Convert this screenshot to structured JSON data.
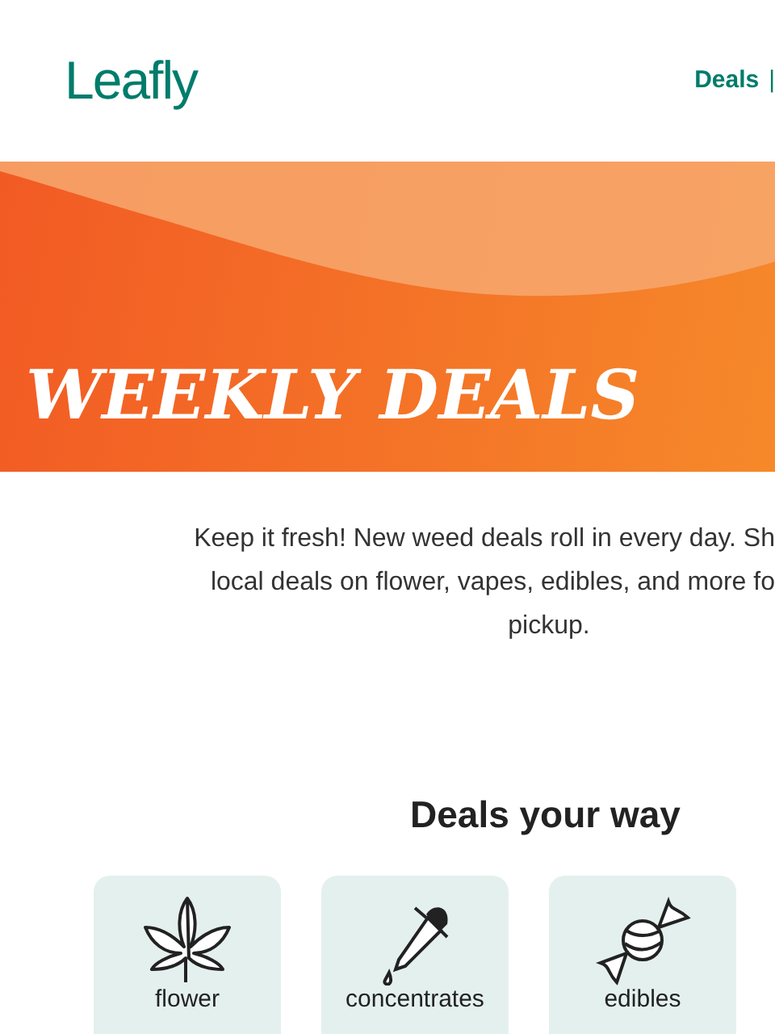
{
  "header": {
    "logo": "Leafly",
    "nav": [
      {
        "label": "Deals",
        "kind": "link"
      },
      {
        "label": "|",
        "kind": "separator"
      }
    ]
  },
  "banner": {
    "title": "WEEKLY DEALS"
  },
  "intro": {
    "lines": [
      "Keep it fresh! New weed deals roll in every day. Sh",
      "local deals on flower, vapes, edibles, and more fo",
      "pickup."
    ]
  },
  "section": {
    "title": "Deals your way"
  },
  "categories": [
    {
      "label": "flower",
      "kind": "leaf"
    },
    {
      "label": "concentrates",
      "kind": "dropper"
    },
    {
      "label": "edibles",
      "kind": "candy"
    }
  ]
}
